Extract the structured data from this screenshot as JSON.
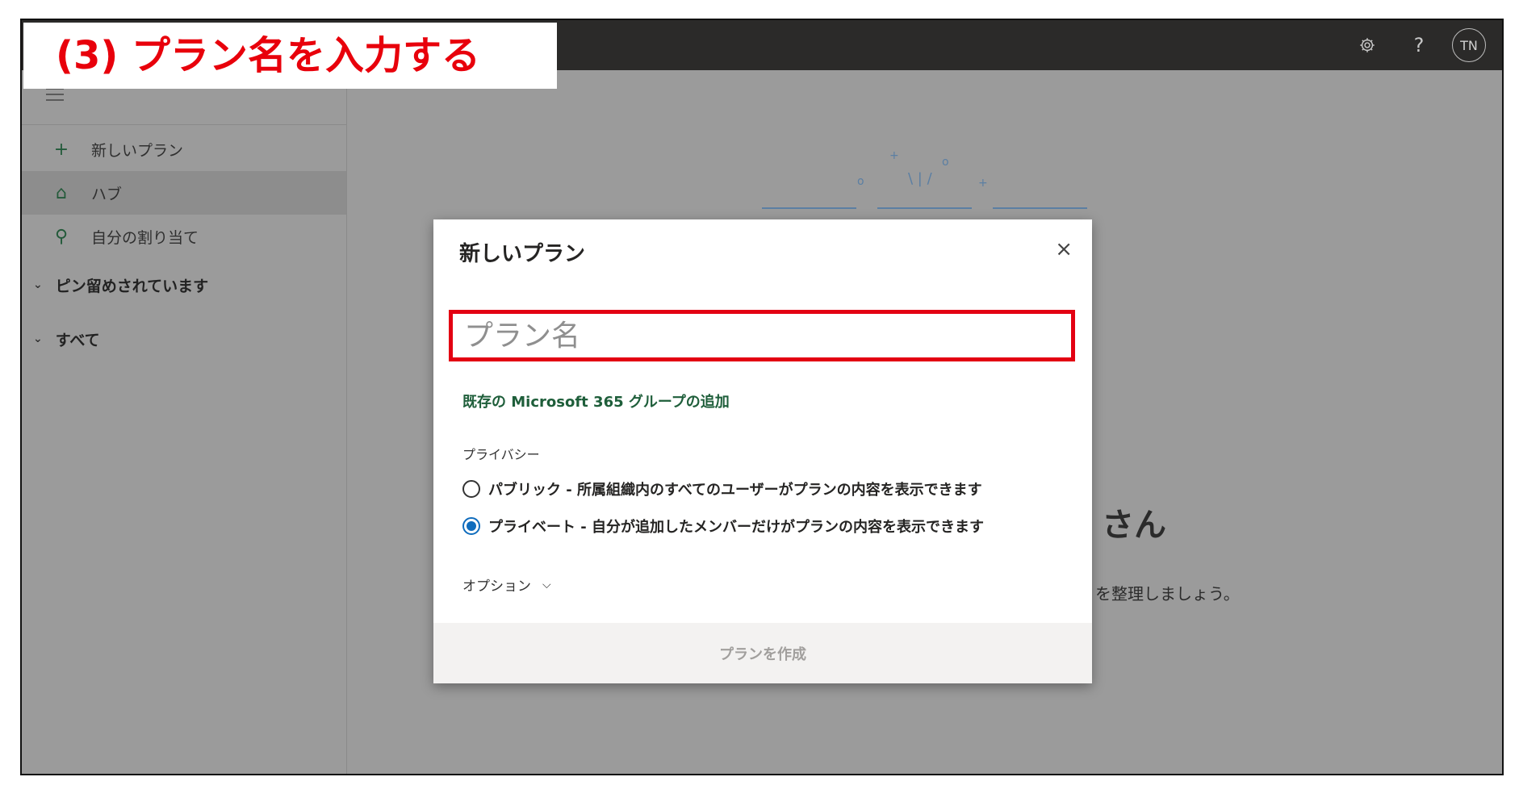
{
  "overlay": {
    "step_title": "(3) プラン名を入力する"
  },
  "topbar": {
    "settings_icon": "gear-icon",
    "help_icon": "?",
    "avatar_initials": "TN"
  },
  "sidebar": {
    "items": [
      {
        "icon": "+",
        "label": "新しいプラン"
      },
      {
        "icon": "⌂",
        "label": "ハブ"
      },
      {
        "icon": "⚲",
        "label": "自分の割り当て"
      }
    ],
    "sections": [
      {
        "label": "ピン留めされています"
      },
      {
        "label": "すべて"
      }
    ]
  },
  "background": {
    "greeting_partial": "さん",
    "subtitle_partial": "を整理しましょう。"
  },
  "dialog": {
    "title": "新しいプラン",
    "close_icon": "×",
    "name_placeholder": "プラン名",
    "add_group_link": "既存の Microsoft 365 グループの追加",
    "privacy_label": "プライバシー",
    "privacy_options": [
      {
        "label": "パブリック - 所属組織内のすべてのユーザーがプランの内容を表示できます",
        "selected": false
      },
      {
        "label": "プライベート - 自分が追加したメンバーだけがプランの内容を表示できます",
        "selected": true
      }
    ],
    "options_label": "オプション",
    "create_button": "プランを作成"
  },
  "colors": {
    "highlight_red": "#e30012",
    "link_green": "#1e5e3a",
    "radio_blue": "#0f6cbd",
    "topbar": "#2b2a29"
  }
}
